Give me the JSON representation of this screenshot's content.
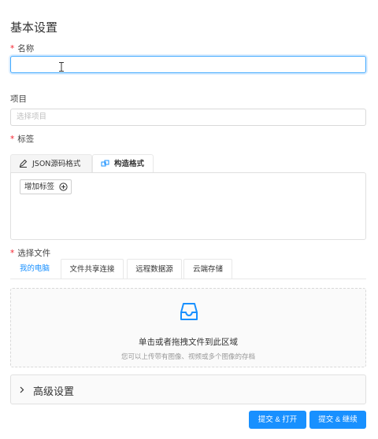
{
  "section_title": "基本设置",
  "name_field": {
    "label": "名称",
    "value": "",
    "placeholder": ""
  },
  "project_field": {
    "label": "项目",
    "placeholder": "选择项目"
  },
  "tags_field": {
    "label": "标签",
    "tabs": [
      {
        "label": "JSON源码格式",
        "icon": "edit-icon"
      },
      {
        "label": "构造格式",
        "icon": "structure-icon",
        "active": true
      }
    ],
    "add_tag_label": "增加标签"
  },
  "file_field": {
    "label": "选择文件",
    "tabs": [
      {
        "label": "我的电脑",
        "active": true
      },
      {
        "label": "文件共享连接"
      },
      {
        "label": "远程数据源"
      },
      {
        "label": "云端存储"
      }
    ],
    "dropzone": {
      "icon": "inbox-icon",
      "title": "单击或者拖拽文件到此区域",
      "hint": "您可以上传带有图像、视频或多个图像的存档"
    }
  },
  "advanced": {
    "label": "高级设置"
  },
  "actions": {
    "submit_open": "提交 & 打开",
    "submit_continue": "提交 & 继续"
  },
  "colors": {
    "primary": "#1890ff",
    "required": "#f5222d"
  }
}
